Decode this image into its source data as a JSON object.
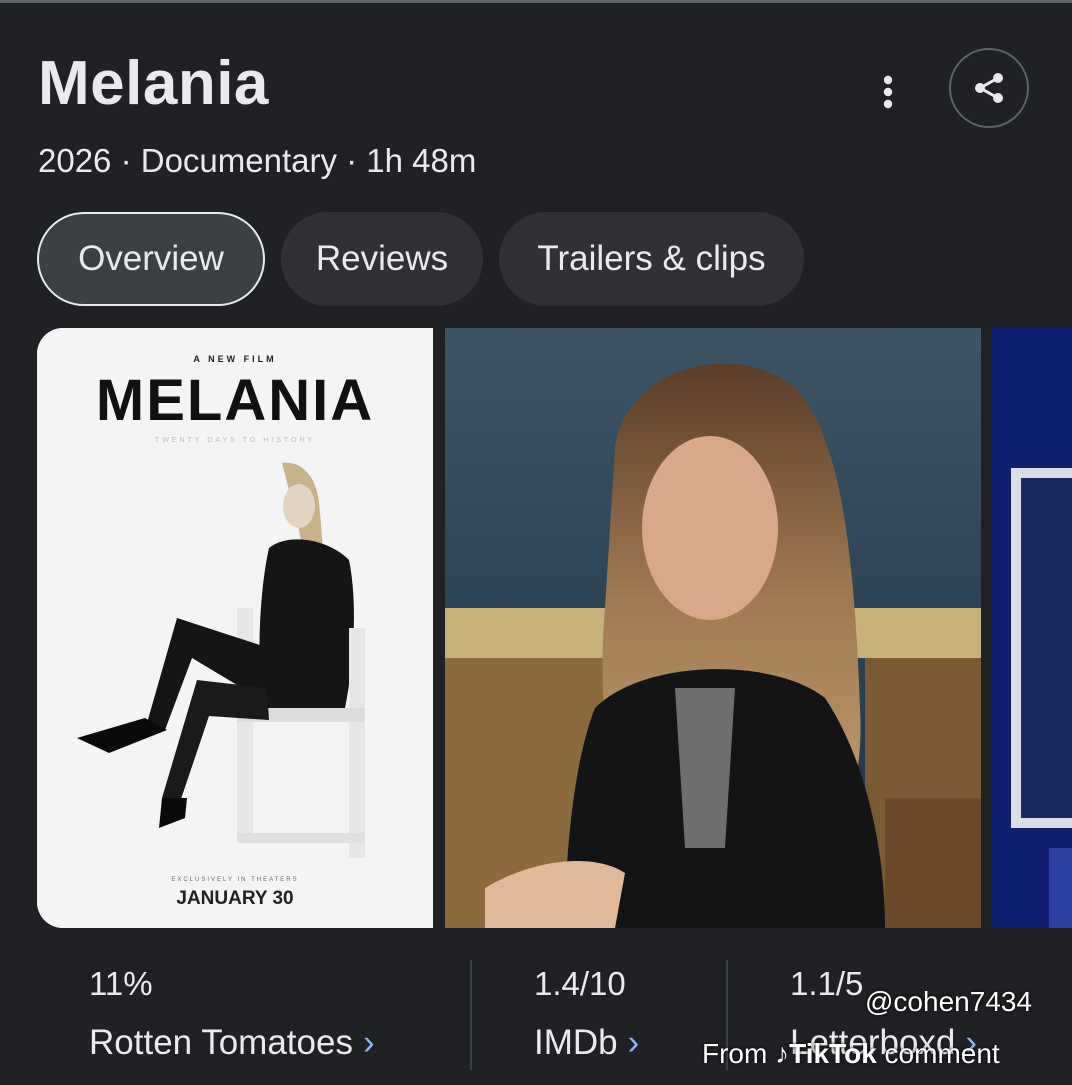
{
  "movie": {
    "title": "Melania",
    "meta": "2026 · Documentary · 1h 48m"
  },
  "tabs": [
    {
      "label": "Overview",
      "active": true
    },
    {
      "label": "Reviews",
      "active": false
    },
    {
      "label": "Trailers & clips",
      "active": false
    }
  ],
  "poster": {
    "kicker": "A NEW FILM",
    "title": "MELANIA",
    "subtitle": "TWENTY DAYS TO HISTORY",
    "exclusive": "EXCLUSIVELY IN THEATERS",
    "date": "JANUARY 30"
  },
  "ratings": [
    {
      "score": "11%",
      "source": "Rotten Tomatoes"
    },
    {
      "score": "1.4/10",
      "source": "IMDb"
    },
    {
      "score": "1.1/5",
      "source": "Letterboxd"
    }
  ],
  "watermark": {
    "handle": "@cohen7434",
    "prefix": "From",
    "brand": "TikTok",
    "suffix": "comment"
  },
  "icons": {
    "more": "more-vert-icon",
    "share": "share-icon",
    "chevron": "chevron-right-icon",
    "tiktok": "tiktok-logo-icon"
  },
  "colors": {
    "background": "#202124",
    "text": "#e8eaed",
    "tab": "#303134",
    "accent_link": "#8ab4f8"
  }
}
